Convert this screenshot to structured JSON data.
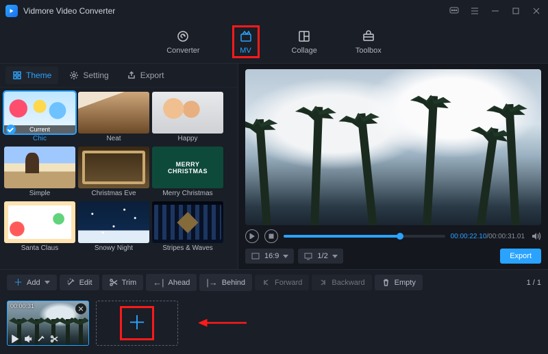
{
  "app": {
    "title": "Vidmore Video Converter"
  },
  "nav": {
    "converter": "Converter",
    "mv": "MV",
    "collage": "Collage",
    "toolbox": "Toolbox"
  },
  "subtabs": {
    "theme": "Theme",
    "setting": "Setting",
    "export": "Export"
  },
  "themes": {
    "current_label": "Current",
    "items": [
      {
        "label": "Chic"
      },
      {
        "label": "Neat"
      },
      {
        "label": "Happy"
      },
      {
        "label": "Simple"
      },
      {
        "label": "Christmas Eve"
      },
      {
        "label": "Merry Christmas"
      },
      {
        "label": "Santa Claus"
      },
      {
        "label": "Snowy Night"
      },
      {
        "label": "Stripes & Waves"
      }
    ]
  },
  "player": {
    "current_time": "00:00:22.10",
    "total_time": "00:00:31.01"
  },
  "export": {
    "aspect": "16:9",
    "zoom": "1/2",
    "button": "Export"
  },
  "toolbar": {
    "add": "Add",
    "edit": "Edit",
    "trim": "Trim",
    "ahead": "Ahead",
    "behind": "Behind",
    "forward": "Forward",
    "backward": "Backward",
    "empty": "Empty",
    "page_current": "1",
    "page_total": "1"
  },
  "clip": {
    "duration": "00:00:31"
  }
}
